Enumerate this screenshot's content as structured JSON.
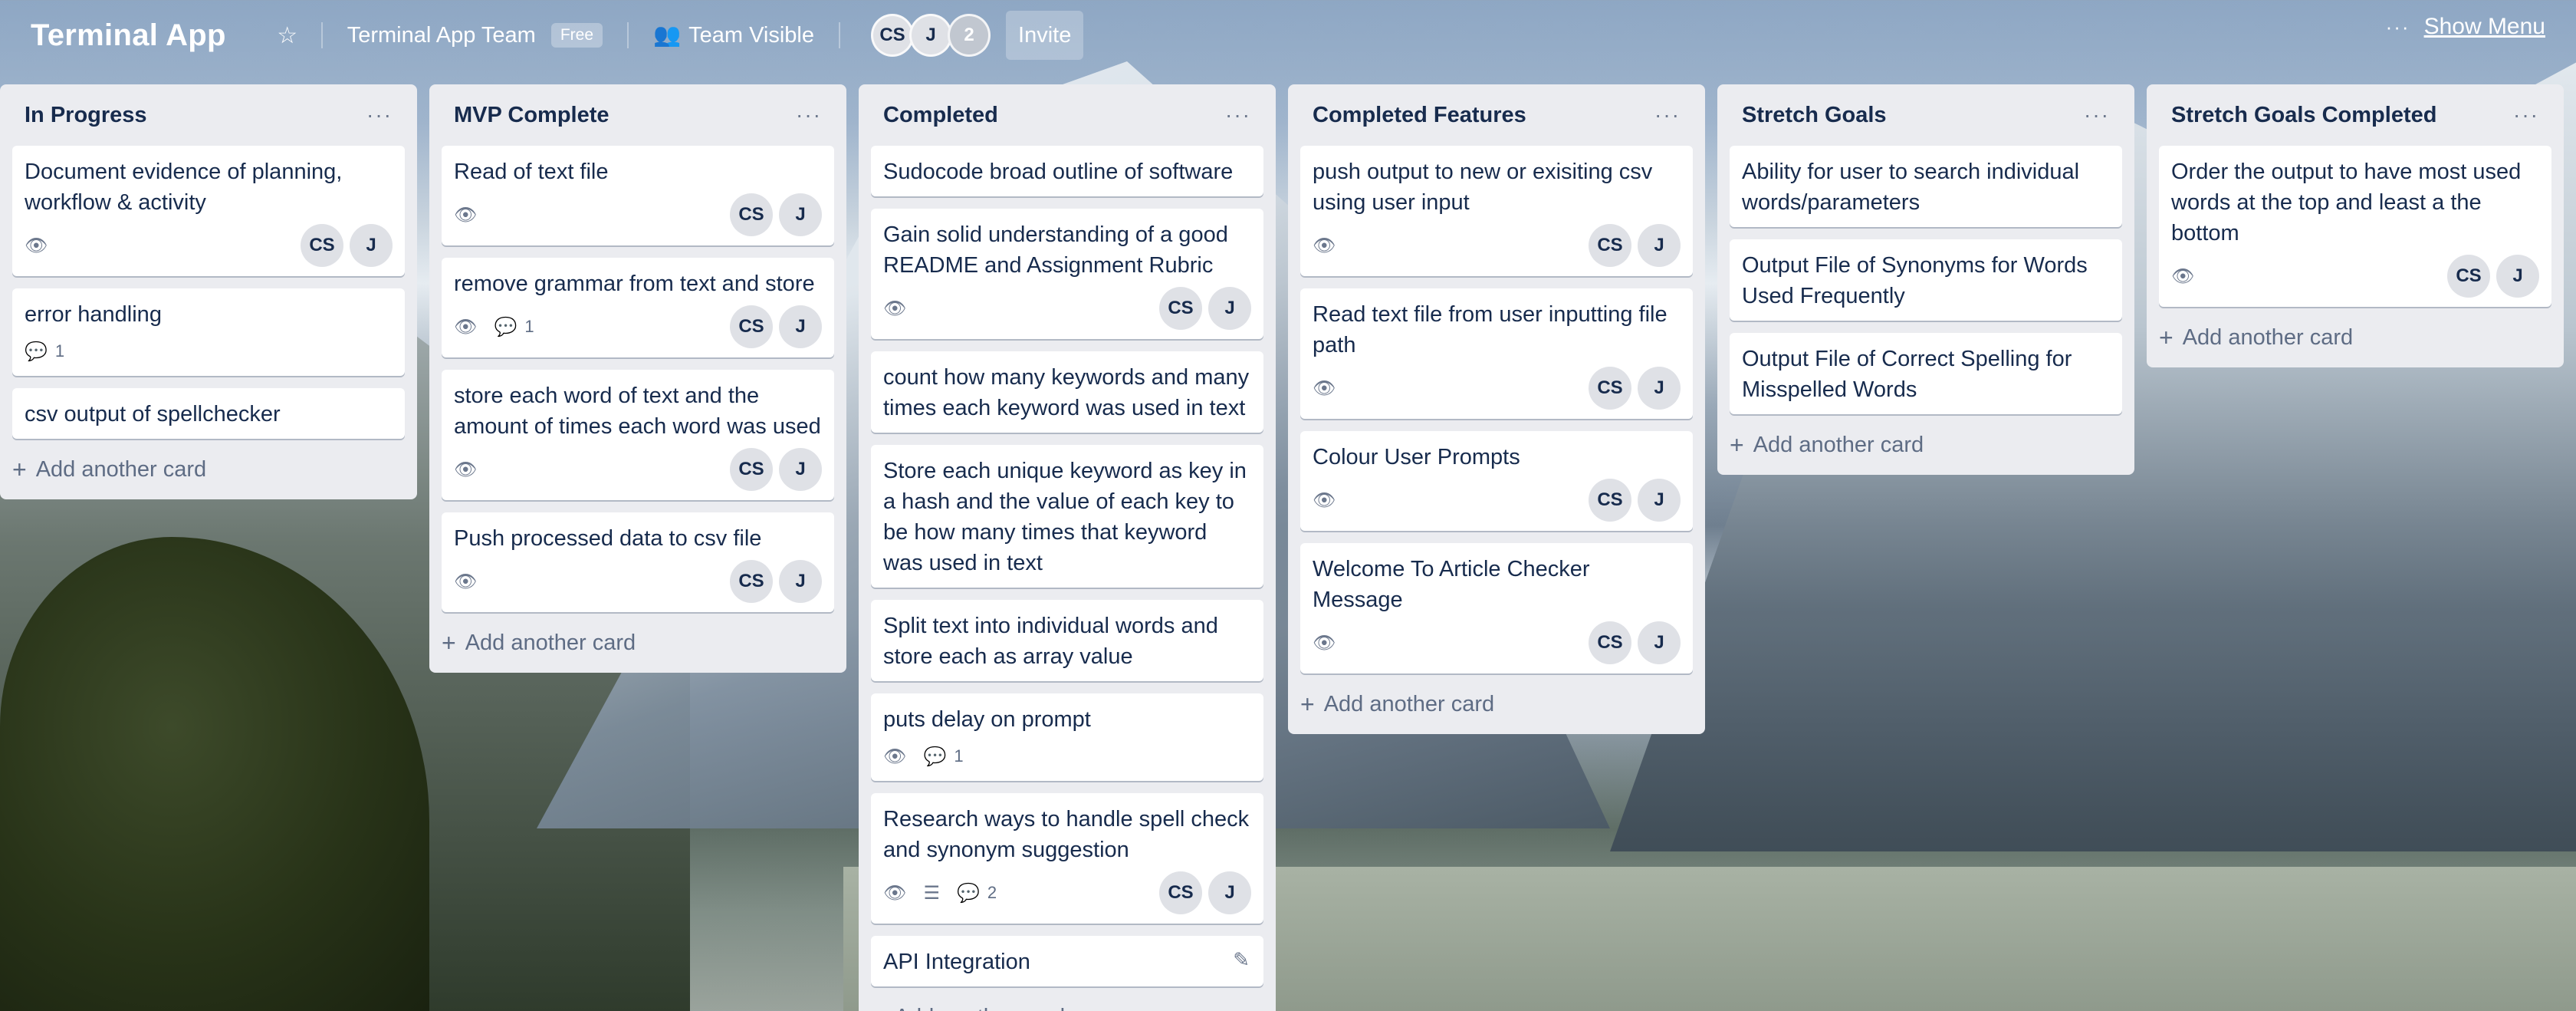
{
  "topbar": {
    "app_title": "Terminal App",
    "star_icon": "star-icon",
    "team_name": "Terminal App Team",
    "team_badge": "Free",
    "visibility_label": "Team Visible",
    "visibility_icon": "team-icon",
    "members": [
      "CS",
      "J"
    ],
    "member_count": "2",
    "invite_label": "Invite",
    "show_menu_label": "Show Menu",
    "more_icon": "ellipsis-icon"
  },
  "lists": [
    {
      "title": "In Progress",
      "cards": [
        {
          "title": "Document evidence of planning, workflow & activity",
          "watch": true,
          "members": [
            "CS",
            "J"
          ]
        },
        {
          "title": "error handling",
          "comments": "1"
        },
        {
          "title": "csv output of spellchecker"
        }
      ],
      "add_label": "Add another card"
    },
    {
      "title": "MVP Complete",
      "cards": [
        {
          "title": "Read of text file",
          "watch": true,
          "members": [
            "CS",
            "J"
          ]
        },
        {
          "title": "remove grammar from text and store",
          "watch": true,
          "comments": "1",
          "members": [
            "CS",
            "J"
          ]
        },
        {
          "title": "store each word of text and the amount of times each word was used",
          "watch": true,
          "members": [
            "CS",
            "J"
          ]
        },
        {
          "title": "Push processed data to csv file",
          "watch": true,
          "members": [
            "CS",
            "J"
          ]
        }
      ],
      "add_label": "Add another card"
    },
    {
      "title": "Completed",
      "cards": [
        {
          "title": "Sudocode broad outline of software"
        },
        {
          "title": "Gain solid understanding of a good README and Assignment Rubric",
          "watch": true,
          "members": [
            "CS",
            "J"
          ]
        },
        {
          "title": "count how many keywords and many times each keyword was used in text"
        },
        {
          "title": "Store each unique keyword as key in a hash and the value of each key to be how many times that keyword was used in text"
        },
        {
          "title": "Split text into individual words and store each as array value"
        },
        {
          "title": "puts delay on prompt",
          "watch": true,
          "comments": "1"
        },
        {
          "title": "Research ways to handle spell check and synonym suggestion",
          "watch": true,
          "description": true,
          "comments": "2",
          "members": [
            "CS",
            "J"
          ]
        },
        {
          "title": "API Integration",
          "editing": true
        }
      ],
      "add_label": "Add another card"
    },
    {
      "title": "Completed Features",
      "cards": [
        {
          "title": "push output to new or exisiting csv using user input",
          "watch": true,
          "members": [
            "CS",
            "J"
          ]
        },
        {
          "title": "Read text file from user inputting file path",
          "watch": true,
          "members": [
            "CS",
            "J"
          ]
        },
        {
          "title": "Colour User Prompts",
          "watch": true,
          "members": [
            "CS",
            "J"
          ]
        },
        {
          "title": "Welcome To Article Checker Message",
          "watch": true,
          "members": [
            "CS",
            "J"
          ]
        }
      ],
      "add_label": "Add another card"
    },
    {
      "title": "Stretch Goals",
      "cards": [
        {
          "title": "Ability for user to search individual words/parameters"
        },
        {
          "title": "Output File of Synonyms for Words Used Frequently"
        },
        {
          "title": "Output File of Correct Spelling for Misspelled Words"
        }
      ],
      "add_label": "Add another card"
    },
    {
      "title": "Stretch Goals Completed",
      "cards": [
        {
          "title": "Order the output to have most used words at the top and least a the bottom",
          "watch": true,
          "members": [
            "CS",
            "J"
          ]
        }
      ],
      "add_label": "Add another card"
    }
  ]
}
